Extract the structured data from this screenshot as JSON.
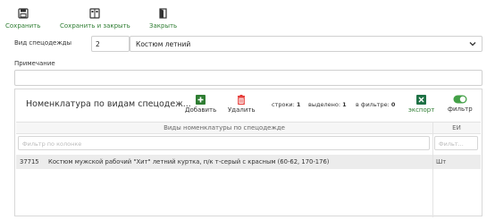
{
  "toolbar": {
    "save_label": "Сохранить",
    "save_close_label": "Сохранить и закрыть",
    "close_label": "Закрыть"
  },
  "form": {
    "type_label": "Вид спецодежды",
    "type_code": "2",
    "type_name": "Костюм летний",
    "note_label": "Примечание",
    "note_value": ""
  },
  "panel": {
    "title": "Номенклатура по видам спецодеж...",
    "add_label": "Добавить",
    "delete_label": "Удалить",
    "rows_label": "строки:",
    "rows_count": "1",
    "selected_label": "выделено:",
    "selected_count": "1",
    "filtered_label": "в фильтре:",
    "filtered_count": "0",
    "export_label": "экспорт",
    "filter_label": "фильтр",
    "filter_toggle_on": true
  },
  "grid": {
    "columns": [
      "Виды номенклатуры по спецодежде",
      "ЕИ"
    ],
    "filter_placeholders": [
      "Фильтр по колонке",
      "Фильт..."
    ],
    "rows": [
      {
        "code": "37715",
        "name": "Костюм мужской рабочий \"Хит\" летний куртка, п/к т-серый с красным (60-62, 170-176)",
        "unit": "Шт"
      }
    ]
  },
  "colors": {
    "accent_green": "#2e7d32",
    "delete_red": "#e53935",
    "excel_green": "#1e7145",
    "toggle_green": "#43a047"
  }
}
